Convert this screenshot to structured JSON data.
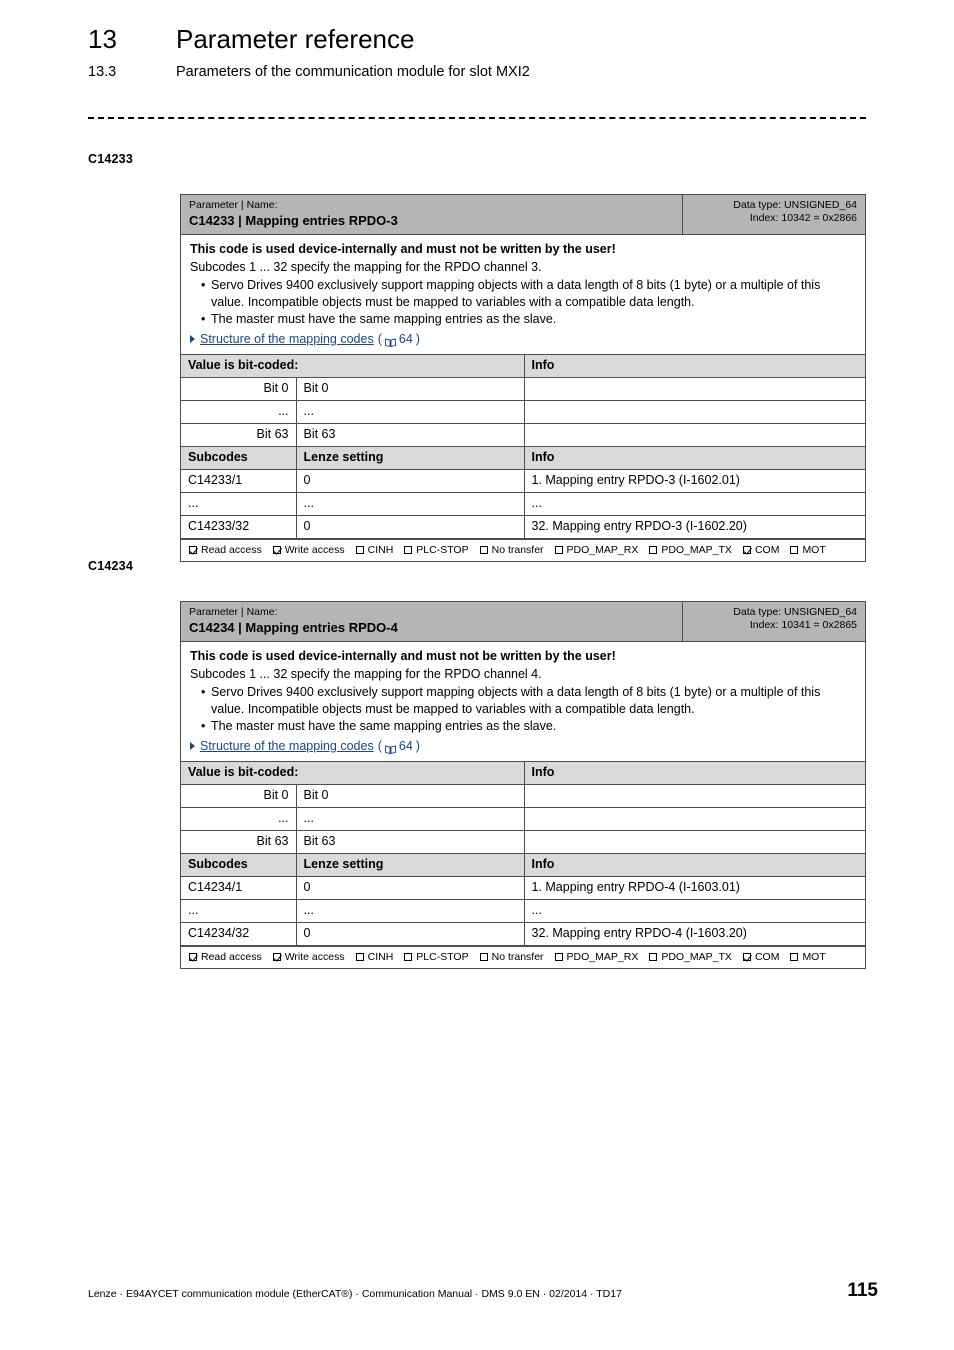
{
  "header": {
    "chapter_number": "13",
    "chapter_title": "Parameter reference",
    "section_number": "13.3",
    "section_title": "Parameters of the communication module for slot MXI2"
  },
  "blocks": [
    {
      "margin_label": "C14233",
      "head": {
        "kicker": "Parameter | Name:",
        "name": "C14233 | Mapping entries RPDO-3",
        "data_type": "Data type: UNSIGNED_64",
        "index": "Index: 10342 = 0x2866"
      },
      "description": {
        "warning": "This code is used device-internally and must not be written by the user!",
        "line": "Subcodes 1 ... 32 specify the mapping for the RPDO channel 3.",
        "bullets": [
          "Servo Drives 9400 exclusively support mapping objects with a data length of 8 bits (1 byte) or a multiple of this value. Incompatible objects must be mapped to variables with a compatible data length.",
          "The master must have the same mapping entries as the slave."
        ],
        "xref_text": "Structure of the mapping codes",
        "xref_open": "(",
        "xref_page": "64",
        "xref_close": ")"
      },
      "bitcoded": {
        "header": [
          "Value is bit-coded:",
          "Info"
        ],
        "rows": [
          {
            "bit_right": "Bit 0",
            "bit_label": "Bit 0",
            "info": ""
          },
          {
            "bit_right": "...",
            "bit_label": "...",
            "info": ""
          },
          {
            "bit_right": "Bit 63",
            "bit_label": "Bit 63",
            "info": ""
          }
        ]
      },
      "subcodes": {
        "header": [
          "Subcodes",
          "Lenze setting",
          "Info"
        ],
        "rows": [
          {
            "subcode": "C14233/1",
            "setting": "0",
            "info": "1. Mapping entry RPDO-3 (I-1602.01)"
          },
          {
            "subcode": "...",
            "setting": "...",
            "info": "..."
          },
          {
            "subcode": "C14233/32",
            "setting": "0",
            "info": "32. Mapping entry RPDO-3 (I-1602.20)"
          }
        ]
      },
      "flags": [
        {
          "label": "Read access",
          "checked": true
        },
        {
          "label": "Write access",
          "checked": true
        },
        {
          "label": "CINH",
          "checked": false
        },
        {
          "label": "PLC-STOP",
          "checked": false
        },
        {
          "label": "No transfer",
          "checked": false
        },
        {
          "label": "PDO_MAP_RX",
          "checked": false
        },
        {
          "label": "PDO_MAP_TX",
          "checked": false
        },
        {
          "label": "COM",
          "checked": true
        },
        {
          "label": "MOT",
          "checked": false
        }
      ]
    },
    {
      "margin_label": "C14234",
      "head": {
        "kicker": "Parameter | Name:",
        "name": "C14234 | Mapping entries RPDO-4",
        "data_type": "Data type: UNSIGNED_64",
        "index": "Index: 10341 = 0x2865"
      },
      "description": {
        "warning": "This code is used device-internally and must not be written by the user!",
        "line": "Subcodes 1 ... 32 specify the mapping for the RPDO channel 4.",
        "bullets": [
          "Servo Drives 9400 exclusively support mapping objects with a data length of 8 bits (1 byte) or a multiple of this value. Incompatible objects must be mapped to variables with a compatible data length.",
          "The master must have the same mapping entries as the slave."
        ],
        "xref_text": "Structure of the mapping codes",
        "xref_open": "(",
        "xref_page": "64",
        "xref_close": ")"
      },
      "bitcoded": {
        "header": [
          "Value is bit-coded:",
          "Info"
        ],
        "rows": [
          {
            "bit_right": "Bit 0",
            "bit_label": "Bit 0",
            "info": ""
          },
          {
            "bit_right": "...",
            "bit_label": "...",
            "info": ""
          },
          {
            "bit_right": "Bit 63",
            "bit_label": "Bit 63",
            "info": ""
          }
        ]
      },
      "subcodes": {
        "header": [
          "Subcodes",
          "Lenze setting",
          "Info"
        ],
        "rows": [
          {
            "subcode": "C14234/1",
            "setting": "0",
            "info": "1. Mapping entry RPDO-4 (I-1603.01)"
          },
          {
            "subcode": "...",
            "setting": "...",
            "info": "..."
          },
          {
            "subcode": "C14234/32",
            "setting": "0",
            "info": "32. Mapping entry RPDO-4 (I-1603.20)"
          }
        ]
      },
      "flags": [
        {
          "label": "Read access",
          "checked": true
        },
        {
          "label": "Write access",
          "checked": true
        },
        {
          "label": "CINH",
          "checked": false
        },
        {
          "label": "PLC-STOP",
          "checked": false
        },
        {
          "label": "No transfer",
          "checked": false
        },
        {
          "label": "PDO_MAP_RX",
          "checked": false
        },
        {
          "label": "PDO_MAP_TX",
          "checked": false
        },
        {
          "label": "COM",
          "checked": true
        },
        {
          "label": "MOT",
          "checked": false
        }
      ]
    }
  ],
  "footer": {
    "text": "Lenze · E94AYCET communication module (EtherCAT®) · Communication Manual · DMS 9.0 EN · 02/2014 · TD17",
    "page_number": "115"
  }
}
